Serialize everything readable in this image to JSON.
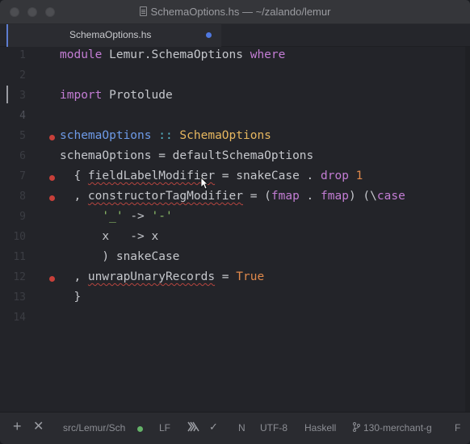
{
  "window": {
    "title": "SchemaOptions.hs — ~/zalando/lemur"
  },
  "tabs": [
    {
      "label": "SchemaOptions.hs",
      "modified": true
    }
  ],
  "editor": {
    "line_numbers": [
      "1",
      "2",
      "3",
      "4",
      "5",
      "6",
      "7",
      "8",
      "9",
      "10",
      "11",
      "12",
      "13",
      "14"
    ],
    "active_line": 4,
    "breakpoint_lines": [
      5,
      7,
      8,
      12
    ],
    "lines": [
      {
        "t1": "module",
        "t2": " Lemur.SchemaOptions ",
        "t3": "where"
      },
      {},
      {
        "t1": "import",
        "t2": " Protolude"
      },
      {},
      {
        "t1": "schemaOptions",
        "t2": " :: ",
        "t3": "SchemaOptions"
      },
      {
        "t1": "schemaOptions = defaultSchemaOptions"
      },
      {
        "t1": "  { ",
        "t2": "fieldLabelModifier",
        "t3": " = snakeCase . ",
        "t4": "drop",
        "t5": " ",
        "t6": "1"
      },
      {
        "t1": "  , ",
        "t2": "constructorTagModifier",
        "t3": " = (",
        "t4": "fmap",
        "t5": " . ",
        "t6": "fmap",
        "t7": ") (\\",
        "t8": "case"
      },
      {
        "t1": "      ",
        "t2": "'_'",
        "t3": " -> ",
        "t4": "'-'"
      },
      {
        "t1": "      x   -> x"
      },
      {
        "t1": "      ) snakeCase"
      },
      {
        "t1": "  , ",
        "t2": "unwrapUnaryRecords",
        "t3": " = ",
        "t4": "True"
      },
      {
        "t1": "  }"
      },
      {}
    ]
  },
  "statusbar": {
    "add_icon": "+",
    "close_icon": "✕",
    "file_path": "src/Lemur/Sch",
    "line_ending": "LF",
    "lint_icon": "lambda-icon",
    "check_icon": "✓",
    "indent_mode": "N",
    "encoding": "UTF-8",
    "grammar": "Haskell",
    "branch": "130-merchant-g",
    "fetch": "F",
    "colors": {
      "git_ok": "#64b268"
    }
  }
}
